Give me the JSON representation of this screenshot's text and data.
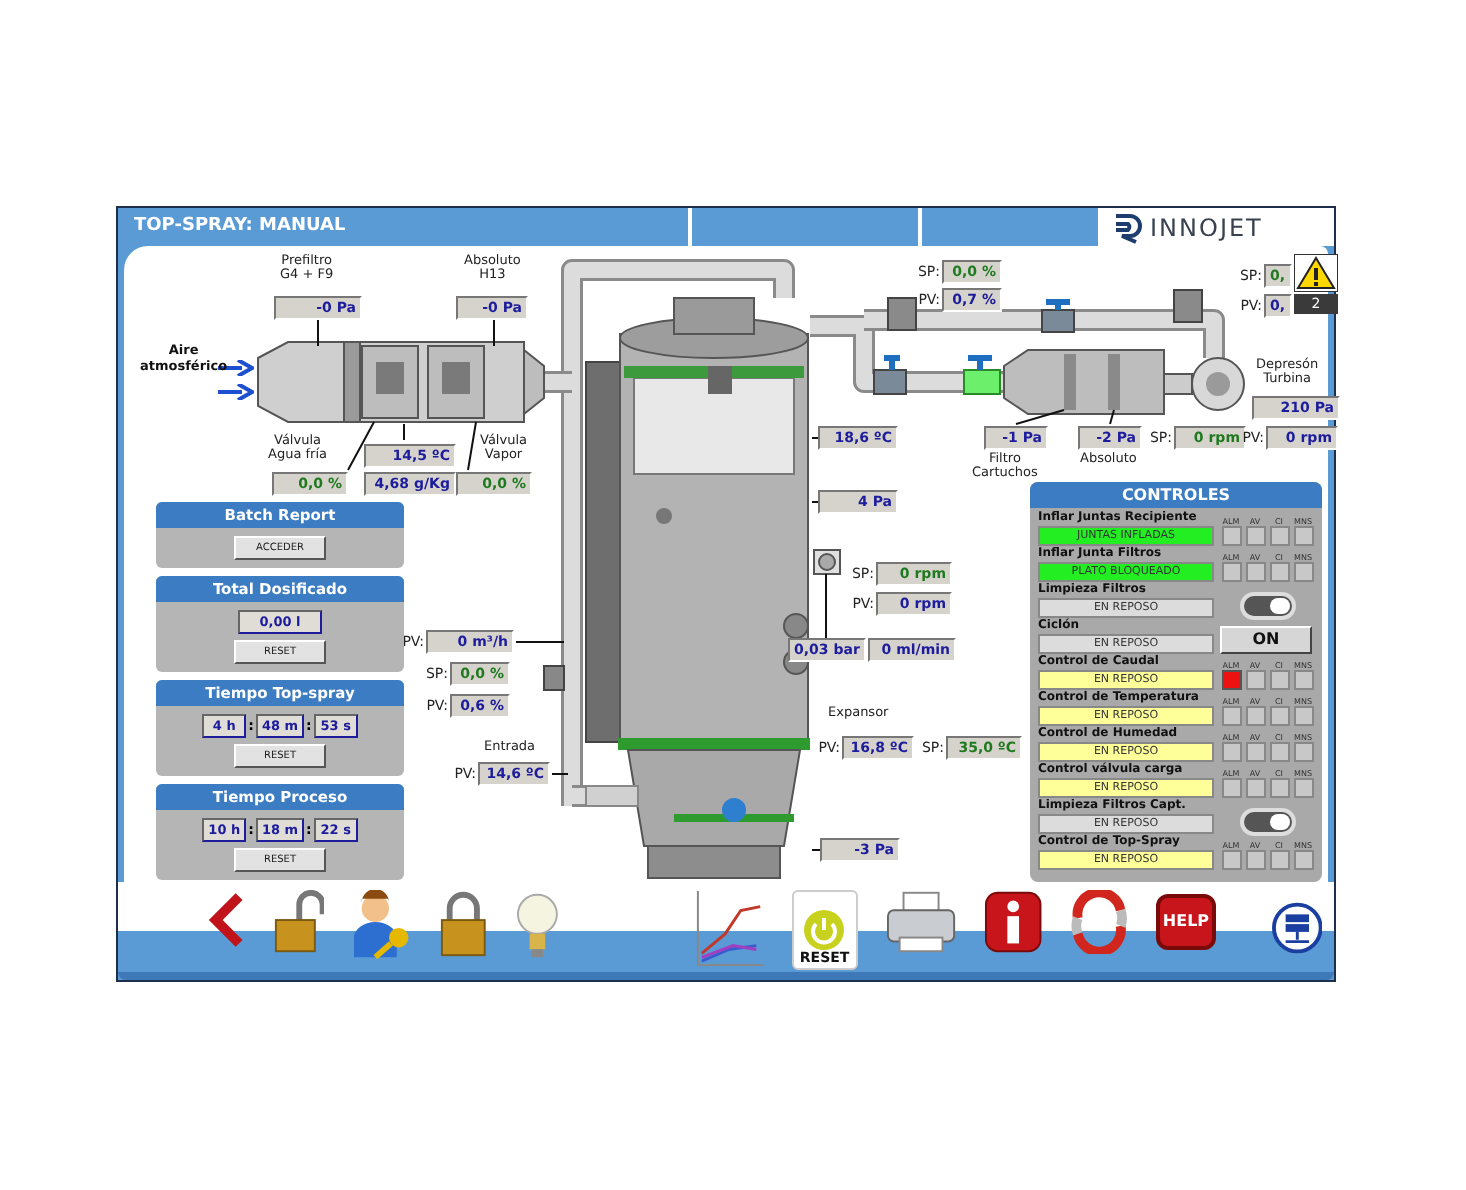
{
  "window": {
    "title": "TOP-SPRAY: MANUAL",
    "logo": "INNOJET"
  },
  "alarm": {
    "count": "2"
  },
  "diagram": {
    "captions": [
      {
        "text": "Prefiltro\nG4 + F9"
      },
      {
        "text": "Absoluto\nH13"
      },
      {
        "text": "Aire\natmosférico"
      },
      {
        "text": "Válvula\nAgua fría"
      },
      {
        "text": "Válvula\nVapor"
      },
      {
        "text": "Entrada"
      },
      {
        "text": "Expansor"
      },
      {
        "text": "Depresón\nTurbina"
      },
      {
        "text": "Filtro\nCartuchos"
      },
      {
        "text": "Absoluto"
      }
    ],
    "readings": [
      {
        "value": "-0 Pa",
        "color": "#1c1c9c"
      },
      {
        "value": "-0 Pa",
        "color": "#1c1c9c"
      },
      {
        "value": "0,0 %",
        "color": "#1f7a1f"
      },
      {
        "value": "14,5 ºC",
        "color": "#1c1c9c"
      },
      {
        "value": "4,68 g/Kg",
        "color": "#1c1c9c"
      },
      {
        "value": "0,0 %",
        "color": "#1f7a1f"
      },
      {
        "prefix": "SP:",
        "value": "0,0 %",
        "color": "#1f7a1f"
      },
      {
        "prefix": "PV:",
        "value": "0,7 %",
        "color": "#1c1c9c"
      },
      {
        "prefix": "SP:",
        "value": "0,",
        "color": "#1f7a1f"
      },
      {
        "prefix": "PV:",
        "value": "0,",
        "color": "#1c1c9c"
      },
      {
        "value": "210 Pa",
        "color": "#1c1c9c"
      },
      {
        "value": "18,6 ºC",
        "color": "#1c1c9c"
      },
      {
        "value": "-1 Pa",
        "color": "#1c1c9c"
      },
      {
        "value": "-2 Pa",
        "color": "#1c1c9c"
      },
      {
        "prefix": "SP:",
        "value": "0 rpm",
        "color": "#1f7a1f"
      },
      {
        "prefix": "PV:",
        "value": "0 rpm",
        "color": "#1c1c9c"
      },
      {
        "value": "4 Pa",
        "color": "#1c1c9c"
      },
      {
        "prefix": "SP:",
        "value": "0 rpm",
        "color": "#1f7a1f"
      },
      {
        "prefix": "PV:",
        "value": "0 rpm",
        "color": "#1c1c9c"
      },
      {
        "value": "0,03 bar",
        "color": "#1c1c9c"
      },
      {
        "value": "0 ml/min",
        "color": "#1c1c9c"
      },
      {
        "prefix": "PV:",
        "value": "0 m³/h",
        "color": "#1c1c9c"
      },
      {
        "prefix": "SP:",
        "value": "0,0 %",
        "color": "#1f7a1f"
      },
      {
        "prefix": "PV:",
        "value": "0,6 %",
        "color": "#1c1c9c"
      },
      {
        "prefix": "PV:",
        "value": "16,8 ºC",
        "color": "#1c1c9c"
      },
      {
        "prefix": "SP:",
        "value": "35,0 ºC",
        "color": "#1f7a1f"
      },
      {
        "prefix": "PV:",
        "value": "14,6 ºC",
        "color": "#1c1c9c"
      },
      {
        "value": "-3 Pa",
        "color": "#1c1c9c"
      }
    ]
  },
  "panels": [
    {
      "title": "Batch Report",
      "kind": "access",
      "button": "ACCEDER"
    },
    {
      "title": "Total Dosificado",
      "kind": "total",
      "value": "0,00 l",
      "button": "RESET"
    },
    {
      "title": "Tiempo Top-spray",
      "kind": "time",
      "parts": [
        "4 h",
        "48 m",
        "53 s"
      ],
      "separators": [
        ":",
        ":"
      ],
      "button": "RESET"
    },
    {
      "title": "Tiempo Proceso",
      "kind": "time",
      "parts": [
        "10 h",
        "18 m",
        "22 s"
      ],
      "separators": [
        ":",
        ":"
      ],
      "button": "RESET"
    }
  ],
  "controls": {
    "title": "CONTROLES",
    "rows": [
      {
        "name": "Inflar Juntas Recipiente",
        "status": "JUNTAS INFLADAS",
        "color": "#22ee22",
        "kind": "indicators",
        "indicators": [
          {
            "label": "ALM",
            "active": false
          },
          {
            "label": "AV",
            "active": false
          },
          {
            "label": "CI",
            "active": false
          },
          {
            "label": "MNS",
            "active": false
          }
        ]
      },
      {
        "name": "Inflar Junta Filtros",
        "status": "PLATO BLOQUEADO",
        "color": "#22ee22",
        "kind": "indicators",
        "indicators": [
          {
            "label": "ALM",
            "active": false
          },
          {
            "label": "AV",
            "active": false
          },
          {
            "label": "CI",
            "active": false
          },
          {
            "label": "MNS",
            "active": false
          }
        ]
      },
      {
        "name": "Limpieza Filtros",
        "status": "EN REPOSO",
        "color": "#dcdcdc",
        "kind": "switch",
        "on": true
      },
      {
        "name": "Ciclón",
        "status": "EN REPOSO",
        "color": "#dcdcdc",
        "kind": "button",
        "button": "ON"
      },
      {
        "name": "Control de Caudal",
        "status": "EN REPOSO",
        "color": "#ffff99",
        "kind": "indicators",
        "indicators": [
          {
            "label": "ALM",
            "active": true
          },
          {
            "label": "AV",
            "active": false
          },
          {
            "label": "CI",
            "active": false
          },
          {
            "label": "MNS",
            "active": false
          }
        ]
      },
      {
        "name": "Control de Temperatura",
        "status": "EN REPOSO",
        "color": "#ffff99",
        "kind": "indicators",
        "indicators": [
          {
            "label": "ALM",
            "active": false
          },
          {
            "label": "AV",
            "active": false
          },
          {
            "label": "CI",
            "active": false
          },
          {
            "label": "MNS",
            "active": false
          }
        ]
      },
      {
        "name": "Control de Humedad",
        "status": "EN REPOSO",
        "color": "#ffff99",
        "kind": "indicators",
        "indicators": [
          {
            "label": "ALM",
            "active": false
          },
          {
            "label": "AV",
            "active": false
          },
          {
            "label": "CI",
            "active": false
          },
          {
            "label": "MNS",
            "active": false
          }
        ]
      },
      {
        "name": "Control válvula carga",
        "status": "EN REPOSO",
        "color": "#ffff99",
        "kind": "indicators",
        "indicators": [
          {
            "label": "ALM",
            "active": false
          },
          {
            "label": "AV",
            "active": false
          },
          {
            "label": "CI",
            "active": false
          },
          {
            "label": "MNS",
            "active": false
          }
        ]
      },
      {
        "name": "Limpieza Filtros Capt.",
        "status": "EN REPOSO",
        "color": "#dcdcdc",
        "kind": "switch",
        "on": true
      },
      {
        "name": "Control de Top-Spray",
        "status": "EN REPOSO",
        "color": "#ffff99",
        "kind": "indicators",
        "indicators": [
          {
            "label": "ALM",
            "active": false
          },
          {
            "label": "AV",
            "active": false
          },
          {
            "label": "CI",
            "active": false
          },
          {
            "label": "MNS",
            "active": false
          }
        ]
      }
    ]
  },
  "toolbar": {
    "reset_label": "RESET",
    "help_label": "HELP"
  }
}
